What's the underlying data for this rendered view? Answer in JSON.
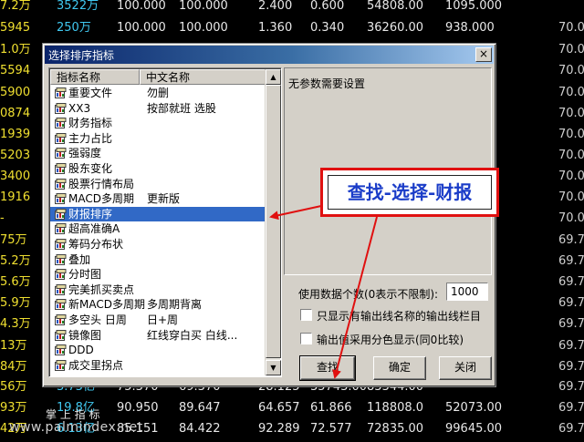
{
  "background_table": {
    "rows": [
      {
        "c0": "7.2万",
        "c1": "3522万",
        "c2": "100.000",
        "c3": "100.000",
        "c4": "2.400",
        "c5": "0.600",
        "c6": "54808.00",
        "c7": "1095.000"
      },
      {
        "c0": "5945",
        "c1": "250万",
        "c2": "100.000",
        "c3": "100.000",
        "c4": "1.360",
        "c5": "0.340",
        "c6": "36260.00",
        "c7": "938.000"
      },
      {
        "c0": "1.0万",
        "c1": "",
        "c2": "",
        "c3": "",
        "c4": "",
        "c5": "",
        "c6": "",
        "c7": ""
      },
      {
        "c0": "5594",
        "c1": "",
        "c2": "",
        "c3": "",
        "c4": "",
        "c5": "",
        "c6": "",
        "c7": ""
      },
      {
        "c0": "5900",
        "c1": "",
        "c2": "",
        "c3": "",
        "c4": "",
        "c5": "",
        "c6": "",
        "c7": ""
      },
      {
        "c0": "0874",
        "c1": "",
        "c2": "",
        "c3": "",
        "c4": "",
        "c5": "",
        "c6": "",
        "c7": ""
      },
      {
        "c0": "1939",
        "c1": "",
        "c2": "",
        "c3": "",
        "c4": "",
        "c5": "",
        "c6": "",
        "c7": ""
      },
      {
        "c0": "5203",
        "c1": "",
        "c2": "",
        "c3": "",
        "c4": "",
        "c5": "",
        "c6": "",
        "c7": ""
      },
      {
        "c0": "3400",
        "c1": "",
        "c2": "",
        "c3": "",
        "c4": "",
        "c5": "",
        "c6": "",
        "c7": ""
      },
      {
        "c0": "1916",
        "c1": "",
        "c2": "",
        "c3": "",
        "c4": "",
        "c5": "",
        "c6": "",
        "c7": ""
      },
      {
        "c0": "-",
        "c1": "",
        "c2": "",
        "c3": "",
        "c4": "",
        "c5": "",
        "c6": "",
        "c7": ""
      },
      {
        "c0": "75万",
        "c1": "",
        "c2": "",
        "c3": "",
        "c4": "",
        "c5": "",
        "c6": "",
        "c7": ""
      },
      {
        "c0": "5.2万",
        "c1": "",
        "c2": "",
        "c3": "",
        "c4": "",
        "c5": "",
        "c6": "",
        "c7": ""
      },
      {
        "c0": "5.6万",
        "c1": "",
        "c2": "",
        "c3": "",
        "c4": "",
        "c5": "",
        "c6": "",
        "c7": ""
      },
      {
        "c0": "5.9万",
        "c1": "",
        "c2": "",
        "c3": "",
        "c4": "",
        "c5": "",
        "c6": "",
        "c7": ""
      },
      {
        "c0": "4.3万",
        "c1": "",
        "c2": "",
        "c3": "",
        "c4": "",
        "c5": "",
        "c6": "",
        "c7": ""
      },
      {
        "c0": "13万",
        "c1": "",
        "c2": "",
        "c3": "",
        "c4": "",
        "c5": "",
        "c6": "",
        "c7": ""
      },
      {
        "c0": "84万",
        "c1": "",
        "c2": "",
        "c3": "",
        "c4": "",
        "c5": "",
        "c6": "",
        "c7": ""
      },
      {
        "c0": "56万",
        "c1": "3.73亿",
        "c2": "75.370",
        "c3": "69.370",
        "c4": "28.125",
        "c5": "35743.00",
        "c6": "83344.00",
        "c7": ""
      },
      {
        "c0": "93万",
        "c1": "19.8亿",
        "c2": "90.950",
        "c3": "89.647",
        "c4": "64.657",
        "c5": "61.866",
        "c6": "118808.0",
        "c7": "52073.00"
      },
      {
        "c0": "42万",
        "c1": "6.13亿",
        "c2": "85.151",
        "c3": "84.422",
        "c4": "92.289",
        "c5": "72.577",
        "c6": "72835.00",
        "c7": "99645.00"
      }
    ],
    "right_col": [
      "70.0",
      "70.0",
      "70.0",
      "70.0",
      "70.0",
      "70.0",
      "70.0",
      "70.0",
      "70.0",
      "70.0",
      "69.7",
      "69.7",
      "69.7",
      "69.7",
      "69.7",
      "69.7",
      "69.7",
      "69.7",
      "69.7",
      "69.7"
    ]
  },
  "watermark": {
    "line1": "掌 上 指 标",
    "line2": "www.palmindex.net"
  },
  "dialog": {
    "title": "选择排序指标",
    "close_label": "×",
    "columns": {
      "name": "指标名称",
      "cn": "中文名称"
    },
    "items": [
      {
        "name": "重要文件",
        "cn": "勿删"
      },
      {
        "name": "XX3",
        "cn": "按部就班 选股"
      },
      {
        "name": "财务指标",
        "cn": ""
      },
      {
        "name": "主力占比",
        "cn": ""
      },
      {
        "name": "强弱度",
        "cn": ""
      },
      {
        "name": "股东变化",
        "cn": ""
      },
      {
        "name": "股票行情布局",
        "cn": ""
      },
      {
        "name": "MACD多周期",
        "cn": "更新版"
      },
      {
        "name": "财报排序",
        "cn": "",
        "selected": true
      },
      {
        "name": "超高准确A",
        "cn": ""
      },
      {
        "name": "筹码分布状",
        "cn": ""
      },
      {
        "name": "叠加",
        "cn": ""
      },
      {
        "name": "分时图",
        "cn": ""
      },
      {
        "name": "完美抓买卖点",
        "cn": ""
      },
      {
        "name": "新MACD多周期",
        "cn": "多周期背离"
      },
      {
        "name": "多空头 日周",
        "cn": "日+周"
      },
      {
        "name": "镜像图",
        "cn": "红线穿白买 白线..."
      },
      {
        "name": "DDD",
        "cn": ""
      },
      {
        "name": "成交里拐点",
        "cn": ""
      }
    ],
    "param_text": "无参数需要设置",
    "count_label": "使用数据个数(0表示不限制):",
    "count_value": "1000",
    "check1_label": "只显示有输出线名称的输出线栏目",
    "check2_label": "输出值采用分色显示(同0比较)",
    "buttons": {
      "find": "查找",
      "ok": "确定",
      "close": "关闭"
    }
  },
  "annotation": {
    "text": "查找-选择-财报"
  },
  "colors": {
    "selected": "#3169c6",
    "annotation_border": "#e01010",
    "annotation_text": "#1a3cc8",
    "arrow": "#e01010"
  }
}
